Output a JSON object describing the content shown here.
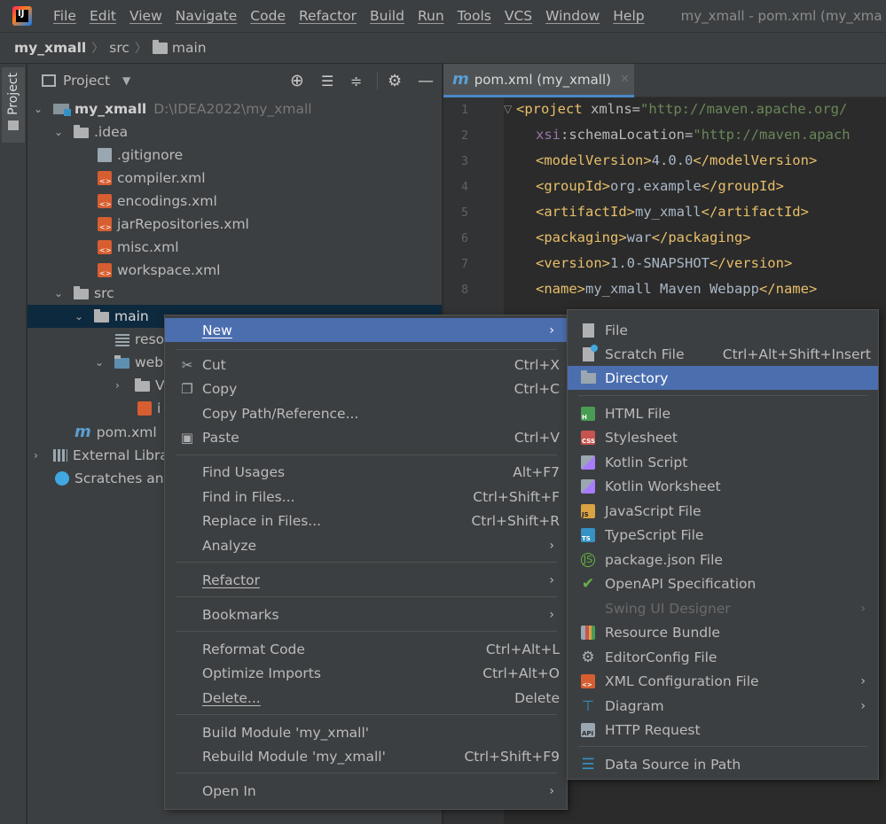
{
  "menubar": {
    "items": [
      "File",
      "Edit",
      "View",
      "Navigate",
      "Code",
      "Refactor",
      "Build",
      "Run",
      "Tools",
      "VCS",
      "Window",
      "Help"
    ],
    "window_title": "my_xmall - pom.xml (my_xma"
  },
  "breadcrumb": {
    "project": "my_xmall",
    "src": "src",
    "main": "main"
  },
  "tool_stripe": {
    "project_label": "Project"
  },
  "project_panel": {
    "header_title": "Project",
    "tree": {
      "root": "my_xmall",
      "root_path": "D:\\IDEA2022\\my_xmall",
      "idea": ".idea",
      "gitignore": ".gitignore",
      "compiler": "compiler.xml",
      "encodings": "encodings.xml",
      "jar_repos": "jarRepositories.xml",
      "misc": "misc.xml",
      "workspace": "workspace.xml",
      "src": "src",
      "main": "main",
      "resources": "reso",
      "webapp": "web",
      "web_inf": "V",
      "index_jsp": "i",
      "pom": "pom.xml",
      "external": "External Libra",
      "scratches": "Scratches and"
    }
  },
  "editor": {
    "tab_label": "pom.xml (my_xmall)",
    "line_numbers": [
      "1",
      "2",
      "3",
      "4",
      "5",
      "6",
      "7",
      "8"
    ],
    "lines": [
      {
        "tag_open": "<project ",
        "attr": "xmlns",
        "eq": "=",
        "val": "\"http://maven.apache.org/"
      },
      {
        "xsi": "xsi",
        "attr": ":schemaLocation",
        "eq": "=",
        "val": "\"http://maven.apach"
      },
      {
        "open": "<modelVersion>",
        "text": "4.0.0",
        "close": "</modelVersion>"
      },
      {
        "open": "<groupId>",
        "text": "org.example",
        "close": "</groupId>"
      },
      {
        "open": "<artifactId>",
        "text": "my_xmall",
        "close": "</artifactId>"
      },
      {
        "open": "<packaging>",
        "text": "war",
        "close": "</packaging>"
      },
      {
        "open": "<version>",
        "text": "1.0-SNAPSHOT",
        "close": "</version>"
      },
      {
        "open": "<name>",
        "text": "my_xmall Maven Webapp",
        "close": "</name>"
      }
    ]
  },
  "context_menu": {
    "new": "New",
    "cut": "Cut",
    "cut_sc": "Ctrl+X",
    "copy": "Copy",
    "copy_sc": "Ctrl+C",
    "copy_path": "Copy Path/Reference...",
    "paste": "Paste",
    "paste_sc": "Ctrl+V",
    "find_usages": "Find Usages",
    "find_usages_sc": "Alt+F7",
    "find_in_files": "Find in Files...",
    "find_in_files_sc": "Ctrl+Shift+F",
    "replace_in_files": "Replace in Files...",
    "replace_in_files_sc": "Ctrl+Shift+R",
    "analyze": "Analyze",
    "refactor": "Refactor",
    "bookmarks": "Bookmarks",
    "reformat": "Reformat Code",
    "reformat_sc": "Ctrl+Alt+L",
    "optimize": "Optimize Imports",
    "optimize_sc": "Ctrl+Alt+O",
    "delete": "Delete...",
    "delete_sc": "Delete",
    "build_module": "Build Module 'my_xmall'",
    "rebuild_module": "Rebuild Module 'my_xmall'",
    "rebuild_module_sc": "Ctrl+Shift+F9",
    "open_in": "Open In"
  },
  "new_submenu": {
    "file": "File",
    "scratch": "Scratch File",
    "scratch_sc": "Ctrl+Alt+Shift+Insert",
    "directory": "Directory",
    "html": "HTML File",
    "stylesheet": "Stylesheet",
    "kotlin_script": "Kotlin Script",
    "kotlin_worksheet": "Kotlin Worksheet",
    "js": "JavaScript File",
    "ts": "TypeScript File",
    "package_json": "package.json File",
    "openapi": "OpenAPI Specification",
    "swing": "Swing UI Designer",
    "resource_bundle": "Resource Bundle",
    "editorconfig": "EditorConfig File",
    "xml_config": "XML Configuration File",
    "diagram": "Diagram",
    "http": "HTTP Request",
    "datasource": "Data Source in Path"
  },
  "colors": {
    "menu_bg": "#3c3f41",
    "editor_bg": "#2b2b2b",
    "highlight": "#4b6eaf",
    "selection": "#0d293e",
    "xml_tag": "#e8bf6a",
    "xml_value": "#6a8759"
  },
  "icons": [
    "app-logo",
    "folder-icon",
    "module-icon",
    "xml-file-icon",
    "maven-icon",
    "scissors-icon",
    "copy-icon",
    "paste-icon",
    "file-icon",
    "directory-icon",
    "html-icon",
    "css-icon",
    "kotlin-icon",
    "js-icon",
    "ts-icon",
    "nodejs-icon",
    "openapi-icon",
    "resource-bundle-icon",
    "gear-icon",
    "diagram-icon",
    "api-icon",
    "database-icon"
  ]
}
